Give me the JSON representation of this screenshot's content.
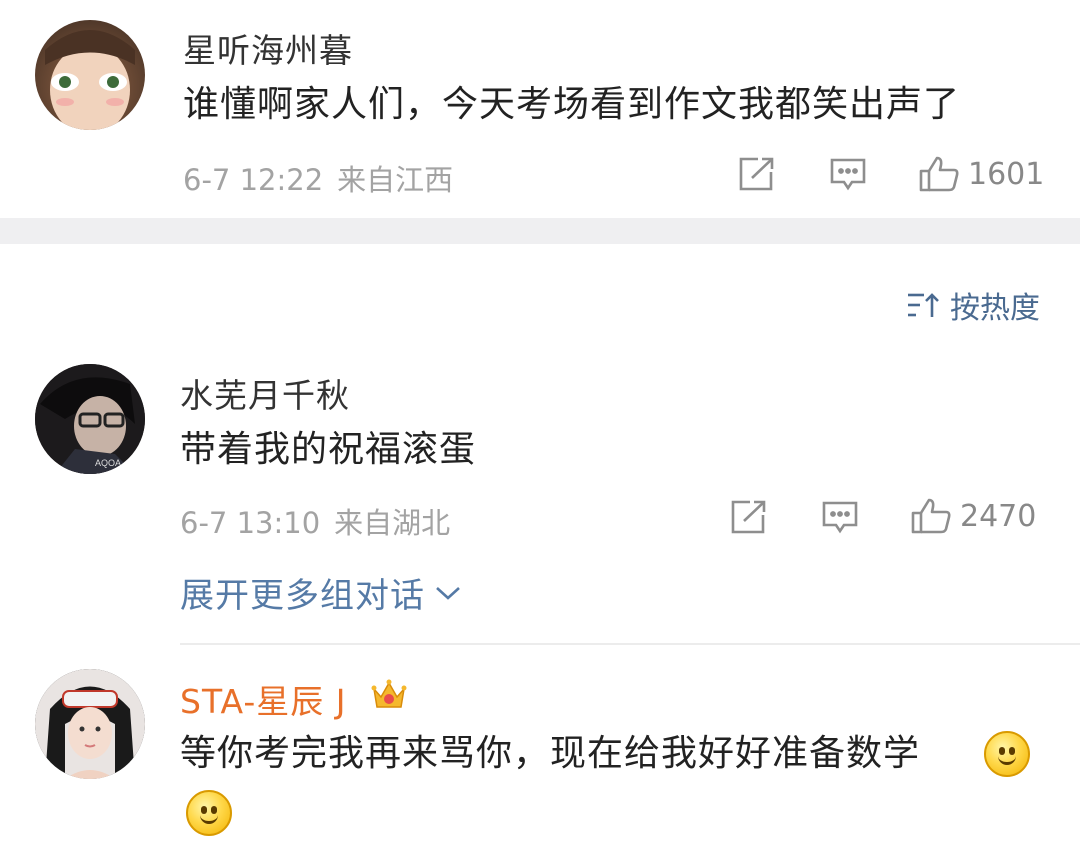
{
  "comments": [
    {
      "username": "星听海州暮",
      "content": "谁懂啊家人们，今天考场看到作文我都笑出声了",
      "date": "6-7 12:22",
      "location": "来自江西",
      "likes": "1601"
    },
    {
      "username": "水芜月千秋",
      "content": "带着我的祝福滚蛋",
      "date": "6-7 13:10",
      "location": "来自湖北",
      "likes": "2470"
    },
    {
      "username": "STA-星辰 J",
      "content": "等你考完我再来骂你，现在给我好好准备数学"
    }
  ],
  "sort": {
    "label": "按热度"
  },
  "expand": {
    "label": "展开更多组对话"
  },
  "colors": {
    "accent_blue": "#557aa6",
    "vip_orange": "#e8702a",
    "meta_gray": "#a3a3a3"
  },
  "icons": [
    "share-icon",
    "comment-icon",
    "like-icon",
    "sort-icon",
    "chevron-down-icon",
    "crown-badge-icon",
    "smile-emoji-icon"
  ]
}
